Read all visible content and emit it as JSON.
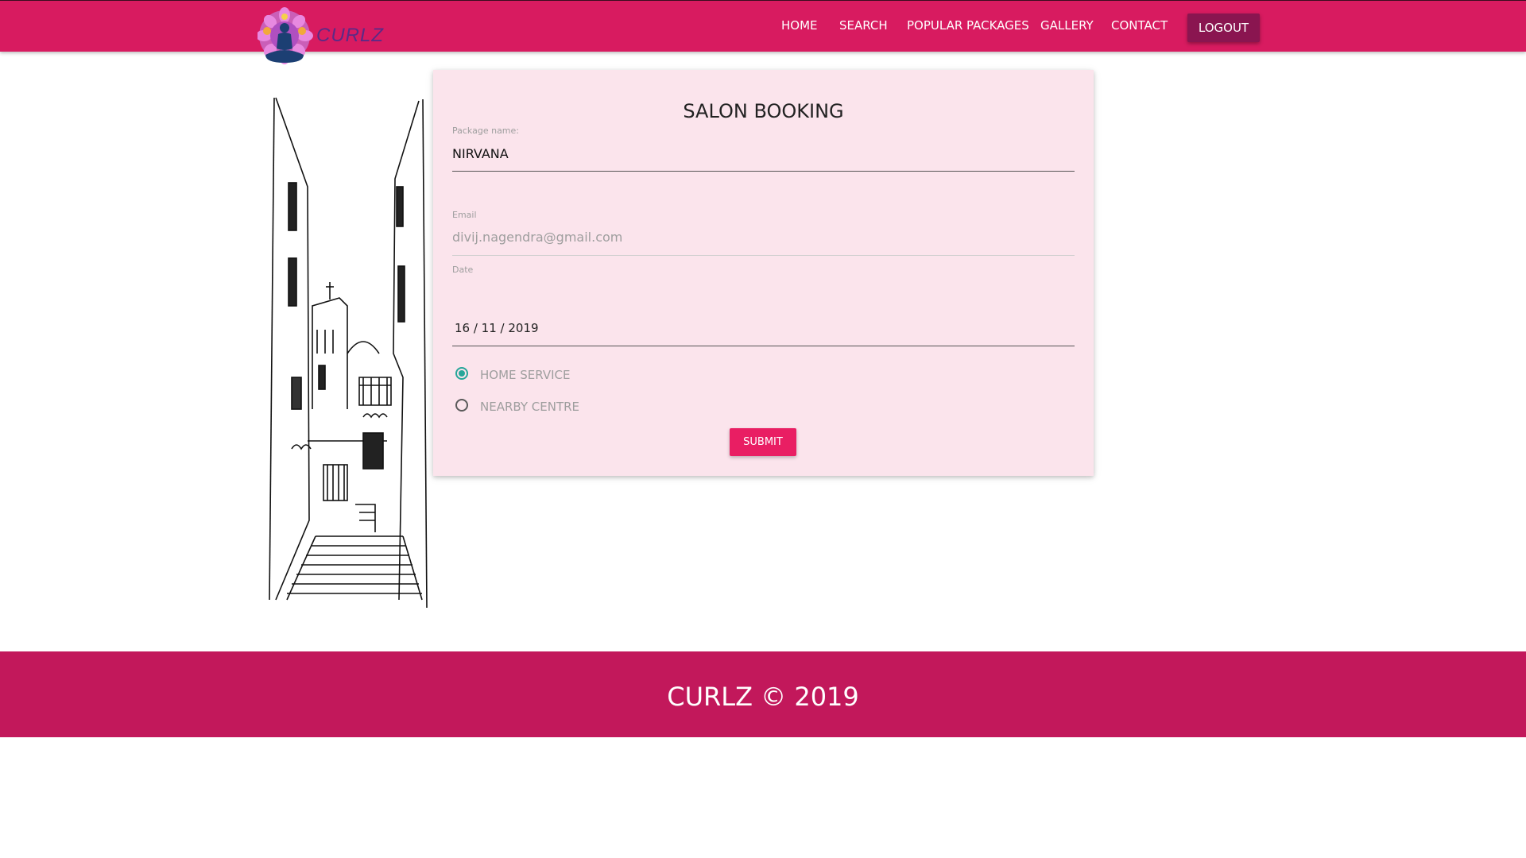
{
  "nav": {
    "brand": "CURLZ",
    "links": [
      "HOME",
      "SEARCH",
      "POPULAR PACKAGES",
      "GALLERY",
      "CONTACT"
    ],
    "logout": "LOGOUT"
  },
  "colors": {
    "primary": "#d81b60",
    "footer": "#c2185b",
    "card": "#fbe4ec",
    "accent": "#e91e63",
    "radio_checked": "#26a69a"
  },
  "form": {
    "title": "SALON BOOKING",
    "package_label": "Package name:",
    "package_value": "NIRVANA",
    "email_label": "Email",
    "email_value": "divij.nagendra@gmail.com",
    "date_label": "Date",
    "date_value": "16 / 11 / 2019",
    "service_options": [
      "HOME SERVICE",
      "NEARBY CENTRE"
    ],
    "selected_service": "HOME SERVICE",
    "submit": "SUBMIT"
  },
  "footer": {
    "text": "CURLZ © 2019"
  },
  "icons": {
    "logo": "meditating-figure-mandala-logo",
    "sketch": "alley-street-sketch-image"
  }
}
